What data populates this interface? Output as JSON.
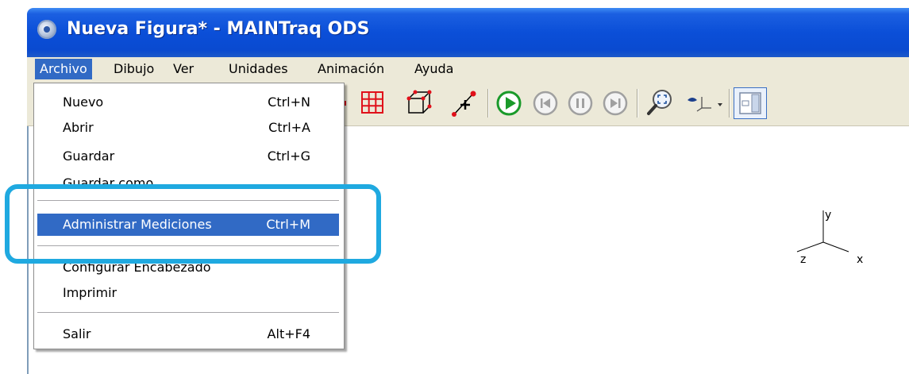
{
  "window": {
    "title": "Nueva Figura* - MAINTraq ODS"
  },
  "menubar": {
    "items": [
      {
        "label": "Archivo",
        "active": true
      },
      {
        "label": "Dibujo"
      },
      {
        "label": "Ver"
      },
      {
        "label": "Unidades"
      },
      {
        "label": "Animación"
      },
      {
        "label": "Ayuda"
      }
    ]
  },
  "toolbar": {
    "icons": [
      "grid-icon",
      "cube-icon",
      "add-point-icon",
      "play-icon",
      "rewind-icon",
      "pause-icon",
      "fast-forward-icon",
      "zoom-fit-icon",
      "view-direction-icon",
      "panel-toggle-icon"
    ],
    "colors": {
      "red": "#e0101a",
      "green": "#1a9a2a",
      "disabled": "#a0a0a0"
    }
  },
  "file_menu": {
    "nuevo": {
      "label": "Nuevo",
      "shortcut": "Ctrl+N"
    },
    "abrir": {
      "label": "Abrir",
      "shortcut": "Ctrl+A"
    },
    "guardar": {
      "label": "Guardar",
      "shortcut": "Ctrl+G"
    },
    "guardar_como": {
      "label": "Guardar como..."
    },
    "administrar": {
      "label": "Administrar Mediciones",
      "shortcut": "Ctrl+M"
    },
    "configurar": {
      "label": "Configurar Encabezado"
    },
    "imprimir": {
      "label": "Imprimir"
    },
    "salir": {
      "label": "Salir",
      "shortcut": "Alt+F4"
    }
  },
  "axis": {
    "x": "x",
    "y": "y",
    "z": "z"
  },
  "highlight_color": "#1fa9e0"
}
